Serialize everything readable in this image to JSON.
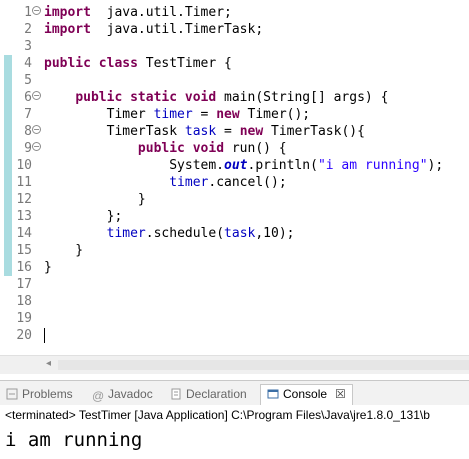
{
  "editor": {
    "lines": [
      {
        "n": "1",
        "fold": "−",
        "segs": [
          [
            "kw",
            "import"
          ],
          [
            "",
            "  java.util.Timer;"
          ]
        ]
      },
      {
        "n": "2",
        "segs": [
          [
            "kw",
            "import"
          ],
          [
            "",
            "  java.util.TimerTask;"
          ]
        ]
      },
      {
        "n": "3",
        "segs": []
      },
      {
        "n": "4",
        "segs": [
          [
            "kw",
            "public class"
          ],
          [
            "",
            " TestTimer {"
          ]
        ]
      },
      {
        "n": "5",
        "segs": []
      },
      {
        "n": "6",
        "fold": "−",
        "segs": [
          [
            "",
            "    "
          ],
          [
            "kw",
            "public static void"
          ],
          [
            "",
            " main(String[] args) {"
          ]
        ]
      },
      {
        "n": "7",
        "segs": [
          [
            "",
            "        Timer "
          ],
          [
            "fld",
            "timer"
          ],
          [
            "",
            " = "
          ],
          [
            "kw",
            "new"
          ],
          [
            "",
            " Timer();"
          ]
        ]
      },
      {
        "n": "8",
        "fold": "−",
        "segs": [
          [
            "",
            "        TimerTask "
          ],
          [
            "fld",
            "task"
          ],
          [
            "",
            " = "
          ],
          [
            "kw",
            "new"
          ],
          [
            "",
            " TimerTask(){"
          ]
        ]
      },
      {
        "n": "9",
        "fold": "−",
        "segs": [
          [
            "",
            "            "
          ],
          [
            "kw",
            "public void"
          ],
          [
            "",
            " run() {"
          ]
        ]
      },
      {
        "n": "10",
        "segs": [
          [
            "",
            "                System."
          ],
          [
            "sfld",
            "out"
          ],
          [
            "",
            ".println("
          ],
          [
            "str",
            "\"i am running\""
          ],
          [
            "",
            ");"
          ]
        ]
      },
      {
        "n": "11",
        "segs": [
          [
            "",
            "                "
          ],
          [
            "fld",
            "timer"
          ],
          [
            "",
            ".cancel();"
          ]
        ]
      },
      {
        "n": "12",
        "segs": [
          [
            "",
            "            }"
          ]
        ]
      },
      {
        "n": "13",
        "segs": [
          [
            "",
            "        };"
          ]
        ]
      },
      {
        "n": "14",
        "segs": [
          [
            "",
            "        "
          ],
          [
            "fld",
            "timer"
          ],
          [
            "",
            ".schedule("
          ],
          [
            "fld",
            "task"
          ],
          [
            "",
            ",10);"
          ]
        ]
      },
      {
        "n": "15",
        "segs": [
          [
            "",
            "    }"
          ]
        ]
      },
      {
        "n": "16",
        "segs": [
          [
            "",
            "}"
          ]
        ]
      },
      {
        "n": "17",
        "segs": []
      },
      {
        "n": "18",
        "segs": []
      },
      {
        "n": "19",
        "segs": []
      },
      {
        "n": "20",
        "segs": []
      }
    ]
  },
  "tabs": {
    "problems": "Problems",
    "javadoc": "Javadoc",
    "declaration": "Declaration",
    "console": "Console",
    "close": "☒"
  },
  "console": {
    "status": "<terminated> TestTimer [Java Application] C:\\Program Files\\Java\\jre1.8.0_131\\b",
    "output": "i am running"
  }
}
